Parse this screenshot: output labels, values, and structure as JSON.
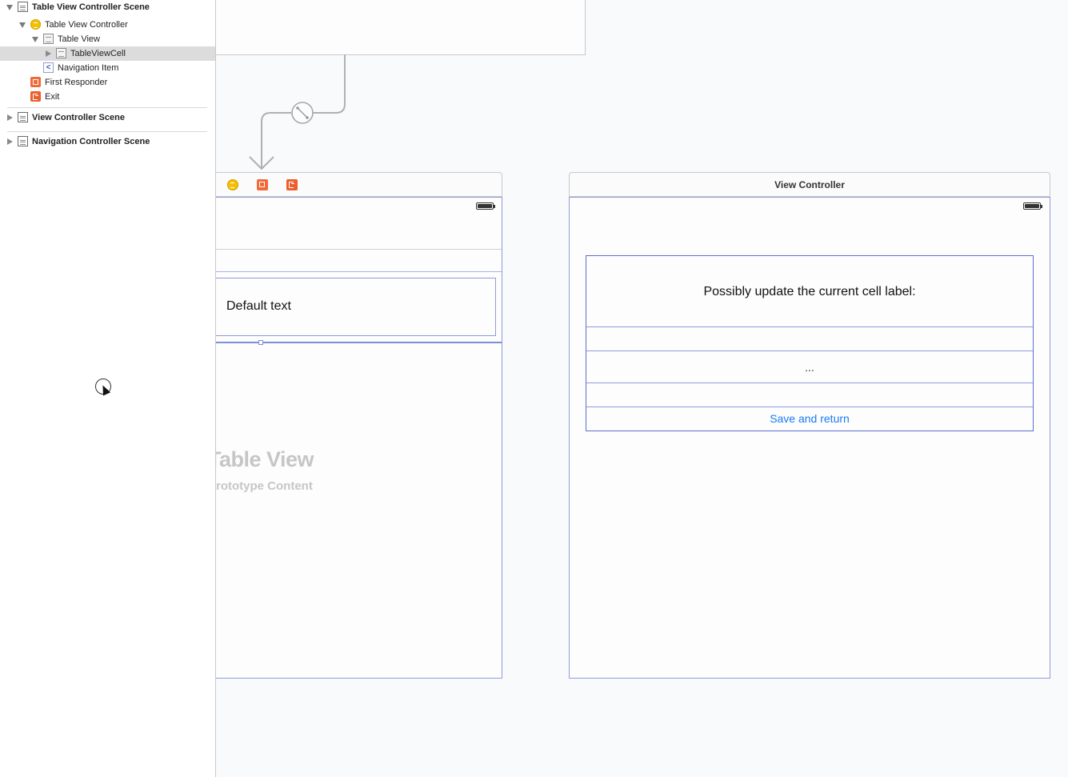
{
  "outline": {
    "items": [
      {
        "label": "Table View Controller Scene",
        "bold": true
      },
      {
        "label": "Table View Controller"
      },
      {
        "label": "Table View"
      },
      {
        "label": "TableViewCell",
        "selected": true
      },
      {
        "label": "Navigation Item",
        "icon_glyph": "<"
      },
      {
        "label": "First Responder"
      },
      {
        "label": "Exit"
      },
      {
        "label": "View Controller Scene",
        "bold": true
      },
      {
        "label": "Navigation Controller Scene",
        "bold": true
      }
    ],
    "icons": {
      "scene": "scene-icon",
      "view_controller": "view-controller-icon",
      "table_view": "table-view-icon",
      "navigation_item": "navigation-item-icon",
      "first_responder": "first-responder-cube-icon",
      "exit": "exit-icon"
    }
  },
  "table_scene": {
    "cell_text": "Default text",
    "placeholder_title": "Table View",
    "placeholder_subtitle": "Prototype Content"
  },
  "view_controller_scene": {
    "title": "View Controller",
    "prompt_label": "Possibly update the current cell label:",
    "text_field_value": "...",
    "save_button_label": "Save and return"
  },
  "colors": {
    "accent_blue": "#1a7cf0",
    "selection_outline": "#8f9bd9",
    "view_controller_yellow": "#f5c000",
    "responder_orange": "#f06a3a"
  }
}
